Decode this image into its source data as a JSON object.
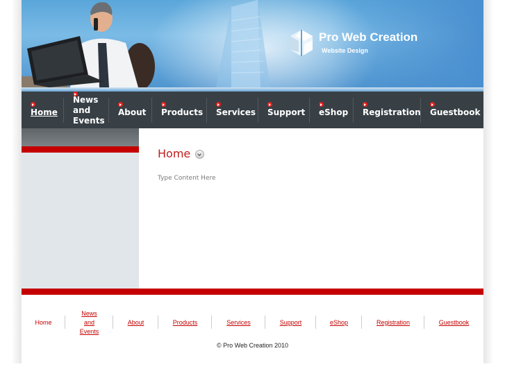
{
  "header": {
    "brand_title": "Pro Web Creation",
    "brand_subtitle": "Website Design"
  },
  "nav": {
    "items": [
      {
        "label": "Home",
        "active": true
      },
      {
        "label": "News\nand\nEvents",
        "active": false
      },
      {
        "label": "About",
        "active": false
      },
      {
        "label": "Products",
        "active": false
      },
      {
        "label": "Services",
        "active": false
      },
      {
        "label": "Support",
        "active": false
      },
      {
        "label": "eShop",
        "active": false
      },
      {
        "label": "Registration",
        "active": false
      },
      {
        "label": "Guestbook",
        "active": false
      }
    ]
  },
  "main": {
    "heading": "Home",
    "content": "Type Content Here"
  },
  "footer": {
    "links": [
      "Home",
      "News and Events",
      "About",
      "Products",
      "Services",
      "Support",
      "eShop",
      "Registration",
      "Guestbook"
    ],
    "copyright": "© Pro Web Creation 2010"
  },
  "colors": {
    "accent_red": "#c40000",
    "nav_bg": "#384046",
    "sidebar_bg": "#e1e6eb"
  }
}
